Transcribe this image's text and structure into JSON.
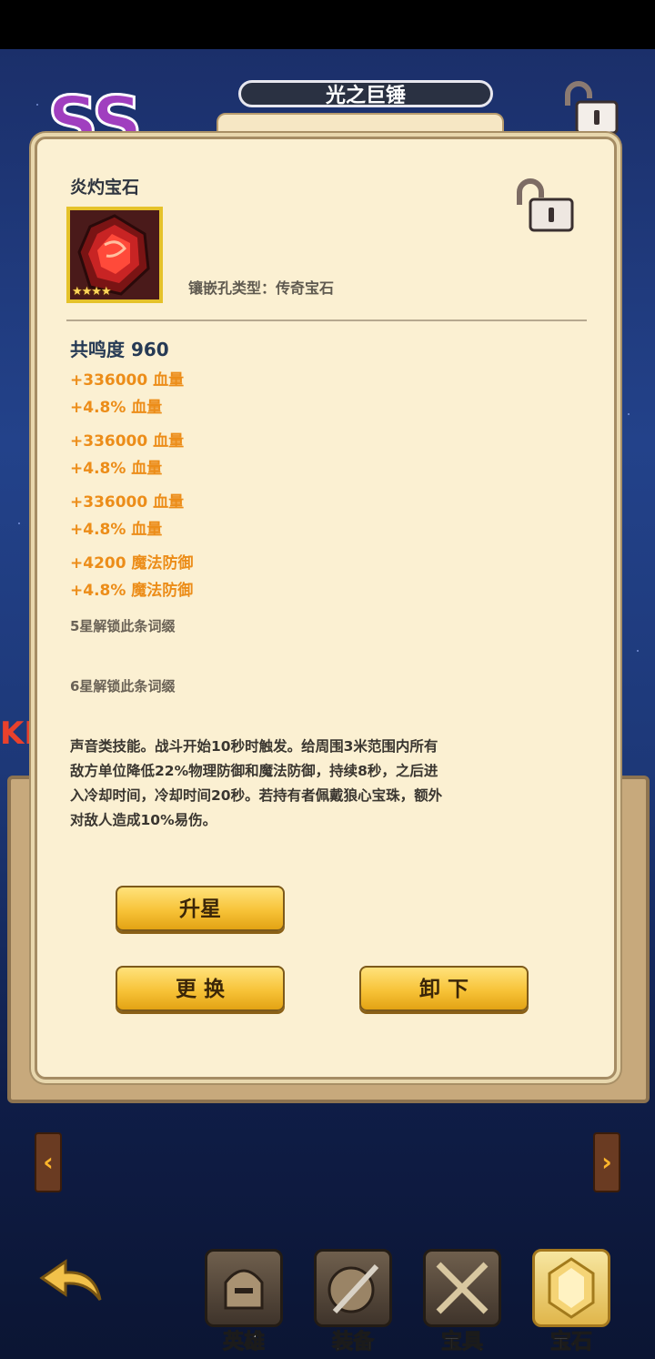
{
  "header": {
    "weapon_title": "光之巨锤",
    "rank_label": "SS",
    "side_partial_text": "KD"
  },
  "gem_popup": {
    "name": "炎灼宝石",
    "stars": "★★★★",
    "socket_type": "镶嵌孔类型：传奇宝石",
    "resonance": "共鸣度 960",
    "stats": [
      "+336000 血量",
      "+4.8% 血量",
      "+336000 血量",
      "+4.8% 血量",
      "+336000 血量",
      "+4.8% 血量",
      "+4200 魔法防御",
      "+4.8% 魔法防御"
    ],
    "locked_affixes": [
      "5星解锁此条词缀",
      "6星解锁此条词缀"
    ],
    "description": "声音类技能。战斗开始10秒时触发。给周围3米范围内所有敌方单位降低22%物理防御和魔法防御，持续8秒，之后进入冷却时间，冷却时间20秒。若持有者佩戴狼心宝珠，额外对敌人造成10%易伤。",
    "buttons": {
      "upgrade_star": "升星",
      "replace": "更 换",
      "unequip": "卸 下"
    }
  },
  "pager": {
    "prev": "‹",
    "next": "›"
  },
  "bottom_nav": [
    {
      "label": "英雄",
      "icon": "helmet-icon"
    },
    {
      "label": "装备",
      "icon": "shield-sword-icon"
    },
    {
      "label": "宝具",
      "icon": "crossed-swords-icon"
    },
    {
      "label": "宝石",
      "icon": "gem-icon",
      "active": true
    }
  ],
  "colors": {
    "stat_orange": "#ec8d19",
    "button_gold": "#f7c338",
    "panel_bg": "#fbf0d2"
  }
}
